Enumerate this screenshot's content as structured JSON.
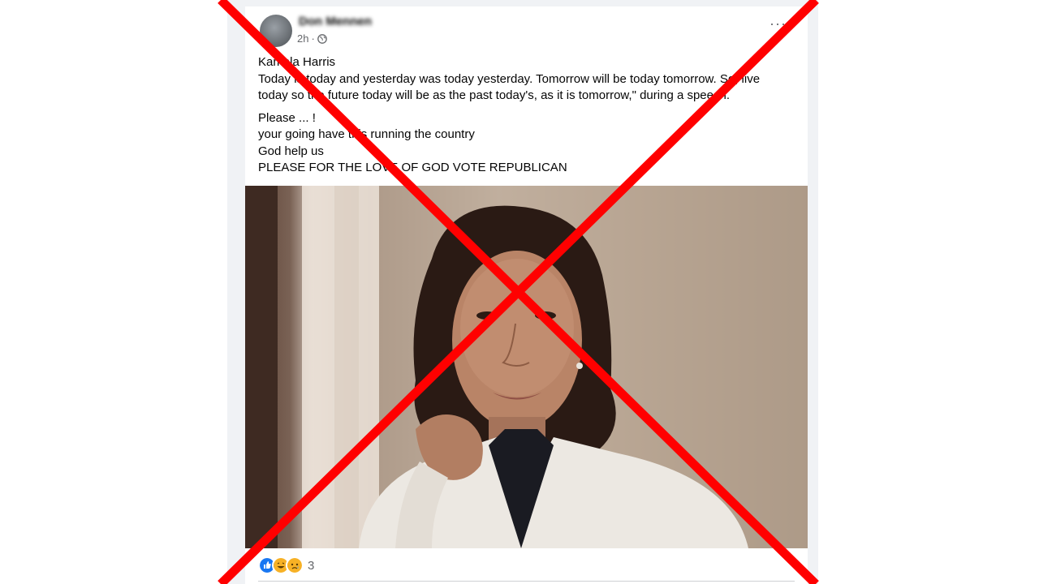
{
  "post": {
    "author": "Don Mennen",
    "timestamp": "2h",
    "privacy_icon": "globe-icon",
    "more_icon": "more-options-icon",
    "more_label": "···",
    "lines": [
      "Kamala Harris",
      "Today is today and yesterday was today yesterday. Tomorrow will be today tomorrow. So, live",
      "today so the future today will be as the past today's, as it is tomorrow,\" during a speech."
    ],
    "lines2": [
      "Please ... !",
      "your going have this running the country",
      "God help us",
      "PLEASE FOR THE LOVE OF GOD VOTE REPUBLICAN"
    ],
    "photo_icon": "portrait-photo",
    "reactions": {
      "icons": [
        "like-icon",
        "haha-icon",
        "sad-icon"
      ],
      "count": "3"
    }
  },
  "overlay": {
    "cross_color": "#ff0000",
    "meaning": "false-claim-cross"
  },
  "colors": {
    "text": "#050505",
    "secondary": "#65676b",
    "like_blue": "#1877f2",
    "emoji_yellow": "#f7b125"
  }
}
